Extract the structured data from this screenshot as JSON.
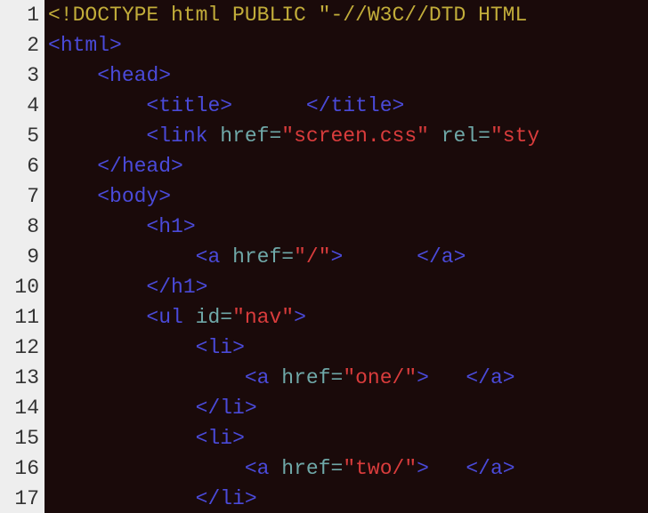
{
  "gutter": {
    "start": 1,
    "end": 17,
    "lines": [
      "1",
      "2",
      "3",
      "4",
      "5",
      "6",
      "7",
      "8",
      "9",
      "10",
      "11",
      "12",
      "13",
      "14",
      "15",
      "16",
      "17"
    ]
  },
  "code": {
    "lines": [
      {
        "indent": 0,
        "tokens": [
          {
            "cls": "tok-doctype",
            "t": "<!DOCTYPE html PUBLIC \"-//W3C//DTD HTML"
          }
        ]
      },
      {
        "indent": 0,
        "tokens": [
          {
            "cls": "tok-punc",
            "t": "<"
          },
          {
            "cls": "tok-tag",
            "t": "html"
          },
          {
            "cls": "tok-punc",
            "t": ">"
          }
        ]
      },
      {
        "indent": 4,
        "tokens": [
          {
            "cls": "tok-punc",
            "t": "<"
          },
          {
            "cls": "tok-tag",
            "t": "head"
          },
          {
            "cls": "tok-punc",
            "t": ">"
          }
        ]
      },
      {
        "indent": 8,
        "tokens": [
          {
            "cls": "tok-punc",
            "t": "<"
          },
          {
            "cls": "tok-tag",
            "t": "title"
          },
          {
            "cls": "tok-punc",
            "t": ">"
          },
          {
            "cls": "tok-text",
            "t": "      "
          },
          {
            "cls": "tok-punc",
            "t": "</"
          },
          {
            "cls": "tok-tag",
            "t": "title"
          },
          {
            "cls": "tok-punc",
            "t": ">"
          }
        ]
      },
      {
        "indent": 8,
        "tokens": [
          {
            "cls": "tok-punc",
            "t": "<"
          },
          {
            "cls": "tok-tag",
            "t": "link"
          },
          {
            "cls": "",
            "t": " "
          },
          {
            "cls": "tok-attr",
            "t": "href"
          },
          {
            "cls": "tok-eq",
            "t": "="
          },
          {
            "cls": "tok-string",
            "t": "\"screen.css\""
          },
          {
            "cls": "",
            "t": " "
          },
          {
            "cls": "tok-attr",
            "t": "rel"
          },
          {
            "cls": "tok-eq",
            "t": "="
          },
          {
            "cls": "tok-string",
            "t": "\"sty"
          }
        ]
      },
      {
        "indent": 4,
        "tokens": [
          {
            "cls": "tok-punc",
            "t": "</"
          },
          {
            "cls": "tok-tag",
            "t": "head"
          },
          {
            "cls": "tok-punc",
            "t": ">"
          }
        ]
      },
      {
        "indent": 4,
        "tokens": [
          {
            "cls": "tok-punc",
            "t": "<"
          },
          {
            "cls": "tok-tag",
            "t": "body"
          },
          {
            "cls": "tok-punc",
            "t": ">"
          }
        ]
      },
      {
        "indent": 8,
        "tokens": [
          {
            "cls": "tok-punc",
            "t": "<"
          },
          {
            "cls": "tok-tag",
            "t": "h1"
          },
          {
            "cls": "tok-punc",
            "t": ">"
          }
        ]
      },
      {
        "indent": 12,
        "tokens": [
          {
            "cls": "tok-punc",
            "t": "<"
          },
          {
            "cls": "tok-tag",
            "t": "a"
          },
          {
            "cls": "",
            "t": " "
          },
          {
            "cls": "tok-attr",
            "t": "href"
          },
          {
            "cls": "tok-eq",
            "t": "="
          },
          {
            "cls": "tok-string",
            "t": "\"/\""
          },
          {
            "cls": "tok-punc",
            "t": ">"
          },
          {
            "cls": "tok-text",
            "t": "      "
          },
          {
            "cls": "tok-punc",
            "t": "</"
          },
          {
            "cls": "tok-tag",
            "t": "a"
          },
          {
            "cls": "tok-punc",
            "t": ">"
          }
        ]
      },
      {
        "indent": 8,
        "tokens": [
          {
            "cls": "tok-punc",
            "t": "</"
          },
          {
            "cls": "tok-tag",
            "t": "h1"
          },
          {
            "cls": "tok-punc",
            "t": ">"
          }
        ]
      },
      {
        "indent": 8,
        "tokens": [
          {
            "cls": "tok-punc",
            "t": "<"
          },
          {
            "cls": "tok-tag",
            "t": "ul"
          },
          {
            "cls": "",
            "t": " "
          },
          {
            "cls": "tok-attr",
            "t": "id"
          },
          {
            "cls": "tok-eq",
            "t": "="
          },
          {
            "cls": "tok-string",
            "t": "\"nav\""
          },
          {
            "cls": "tok-punc",
            "t": ">"
          }
        ]
      },
      {
        "indent": 12,
        "tokens": [
          {
            "cls": "tok-punc",
            "t": "<"
          },
          {
            "cls": "tok-tag",
            "t": "li"
          },
          {
            "cls": "tok-punc",
            "t": ">"
          }
        ]
      },
      {
        "indent": 16,
        "tokens": [
          {
            "cls": "tok-punc",
            "t": "<"
          },
          {
            "cls": "tok-tag",
            "t": "a"
          },
          {
            "cls": "",
            "t": " "
          },
          {
            "cls": "tok-attr",
            "t": "href"
          },
          {
            "cls": "tok-eq",
            "t": "="
          },
          {
            "cls": "tok-string",
            "t": "\"one/\""
          },
          {
            "cls": "tok-punc",
            "t": ">"
          },
          {
            "cls": "tok-text",
            "t": "   "
          },
          {
            "cls": "tok-punc",
            "t": "</"
          },
          {
            "cls": "tok-tag",
            "t": "a"
          },
          {
            "cls": "tok-punc",
            "t": ">"
          }
        ]
      },
      {
        "indent": 12,
        "tokens": [
          {
            "cls": "tok-punc",
            "t": "</"
          },
          {
            "cls": "tok-tag",
            "t": "li"
          },
          {
            "cls": "tok-punc",
            "t": ">"
          }
        ]
      },
      {
        "indent": 12,
        "tokens": [
          {
            "cls": "tok-punc",
            "t": "<"
          },
          {
            "cls": "tok-tag",
            "t": "li"
          },
          {
            "cls": "tok-punc",
            "t": ">"
          }
        ]
      },
      {
        "indent": 16,
        "tokens": [
          {
            "cls": "tok-punc",
            "t": "<"
          },
          {
            "cls": "tok-tag",
            "t": "a"
          },
          {
            "cls": "",
            "t": " "
          },
          {
            "cls": "tok-attr",
            "t": "href"
          },
          {
            "cls": "tok-eq",
            "t": "="
          },
          {
            "cls": "tok-string",
            "t": "\"two/\""
          },
          {
            "cls": "tok-punc",
            "t": ">"
          },
          {
            "cls": "tok-text",
            "t": "   "
          },
          {
            "cls": "tok-punc",
            "t": "</"
          },
          {
            "cls": "tok-tag",
            "t": "a"
          },
          {
            "cls": "tok-punc",
            "t": ">"
          }
        ]
      },
      {
        "indent": 12,
        "tokens": [
          {
            "cls": "tok-punc",
            "t": "</"
          },
          {
            "cls": "tok-tag",
            "t": "li"
          },
          {
            "cls": "tok-punc",
            "t": ">"
          }
        ]
      }
    ]
  }
}
